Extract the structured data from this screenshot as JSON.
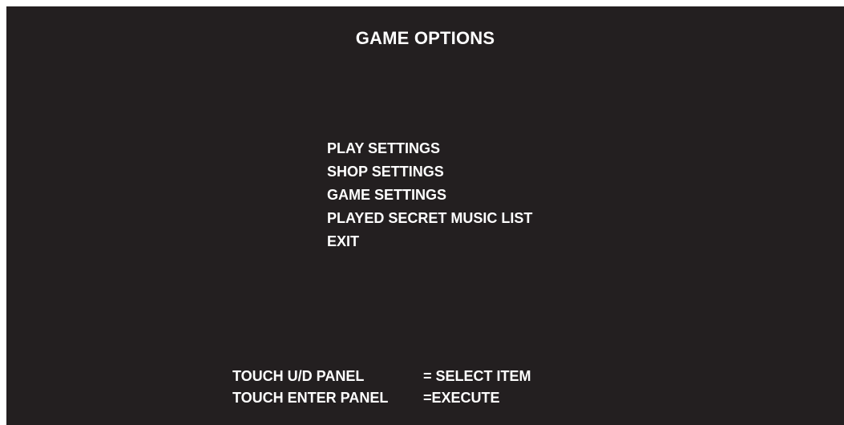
{
  "screen": {
    "title": "GAME OPTIONS",
    "background_color": "#231f20",
    "text_color": "#ffffff"
  },
  "menu": {
    "items": [
      {
        "id": "play-settings",
        "label": "PLAY SETTINGS"
      },
      {
        "id": "shop-settings",
        "label": "SHOP SETTINGS"
      },
      {
        "id": "game-settings",
        "label": "GAME SETTINGS"
      },
      {
        "id": "played-secret-music-list",
        "label": "PLAYED SECRET MUSIC LIST"
      },
      {
        "id": "exit",
        "label": "EXIT"
      }
    ]
  },
  "help": {
    "rows": [
      {
        "key": "TOUCH U/D PANEL",
        "action": "= SELECT ITEM"
      },
      {
        "key": "TOUCH ENTER PANEL",
        "action": "=EXECUTE"
      }
    ]
  }
}
